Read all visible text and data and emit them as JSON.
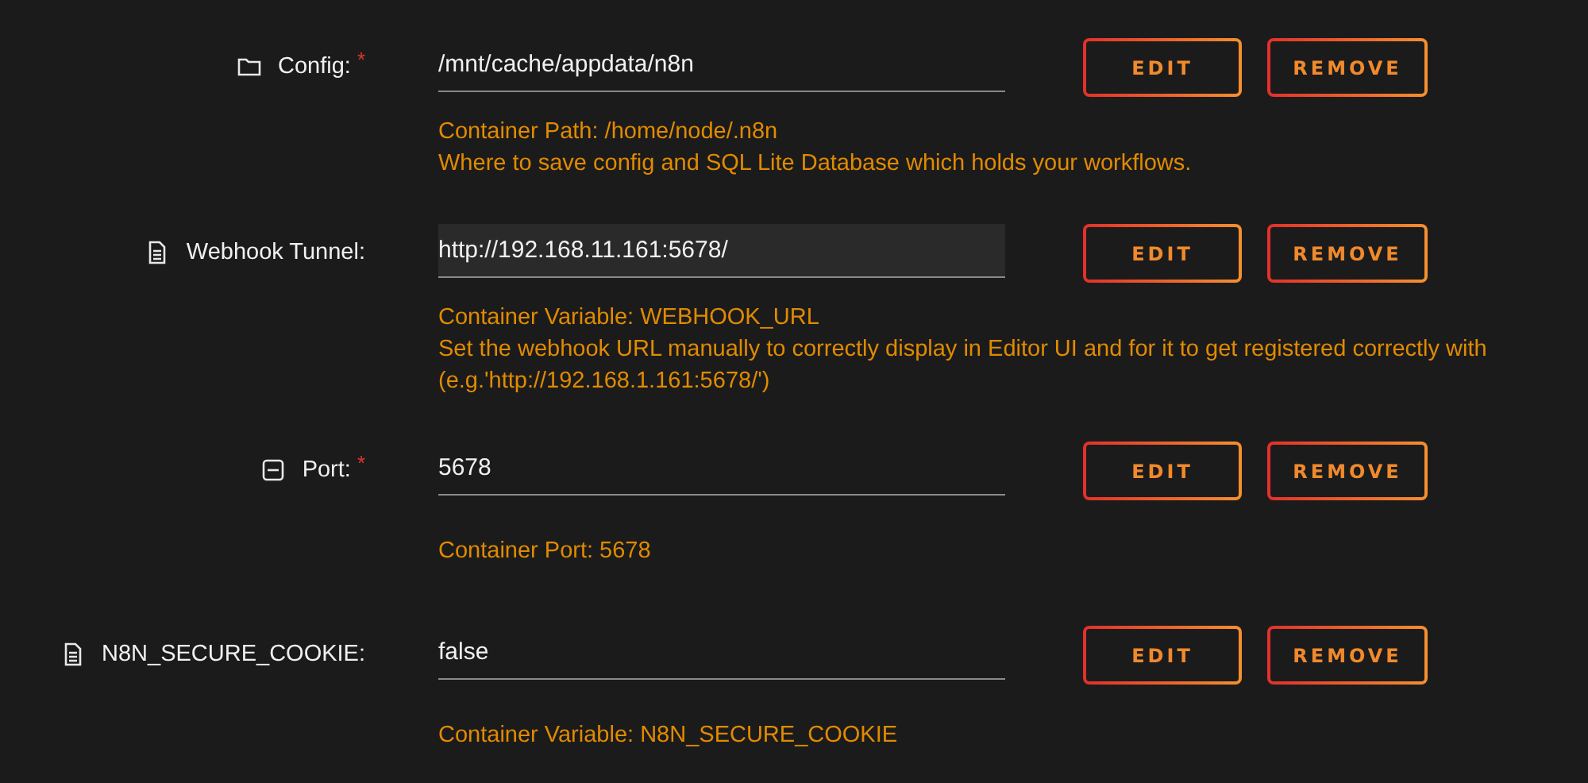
{
  "settings": [
    {
      "kind": "folder",
      "label": "Config:",
      "required_mark": "*",
      "value": "/mnt/cache/appdata/n8n",
      "focused": false,
      "help": [
        "Container Path: /home/node/.n8n",
        "Where to save config and SQL Lite Database which holds your workflows."
      ],
      "buttons": [
        "EDIT",
        "REMOVE"
      ]
    },
    {
      "kind": "document",
      "label": "Webhook Tunnel:",
      "value": "http://192.168.11.161:5678/",
      "focused": true,
      "help": [
        "Container Variable: WEBHOOK_URL",
        "Set the webhook URL manually to correctly display in Editor UI and for it to get registered correctly with",
        "(e.g.'http://192.168.1.161:5678/')"
      ],
      "buttons": [
        "EDIT",
        "REMOVE"
      ]
    },
    {
      "kind": "port",
      "label": "Port:",
      "required_mark": "*",
      "value": "5678",
      "focused": false,
      "help": [
        "Container Port: 5678"
      ],
      "buttons": [
        "EDIT",
        "REMOVE"
      ]
    },
    {
      "kind": "document",
      "label": "N8N_SECURE_COOKIE:",
      "value": "false",
      "focused": false,
      "help": [
        "Container Variable: N8N_SECURE_COOKIE"
      ],
      "buttons": [
        "EDIT",
        "REMOVE"
      ]
    }
  ]
}
